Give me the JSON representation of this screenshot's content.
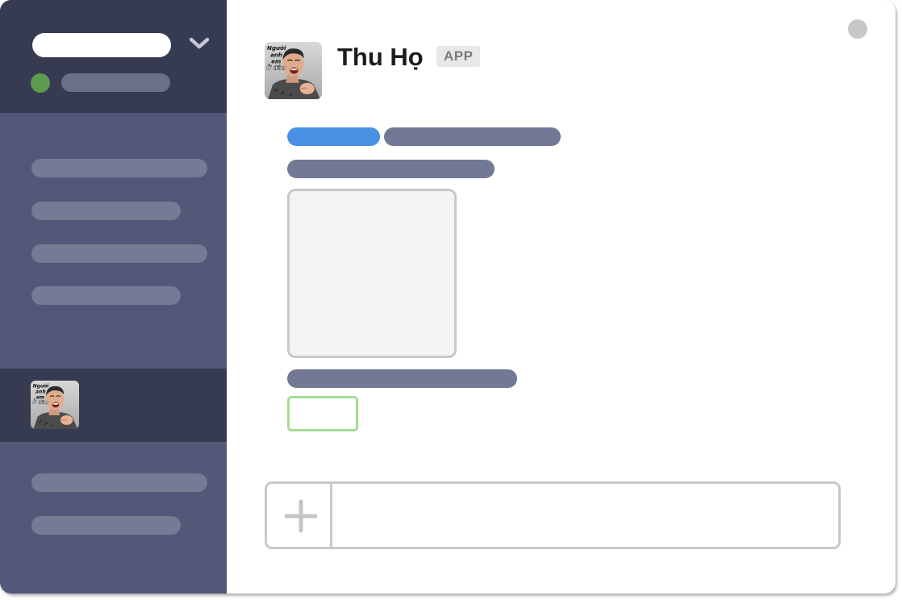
{
  "app": {
    "bot_name": "Thu Họ",
    "badge": "APP"
  },
  "avatar": {
    "caption_lines": [
      "Người",
      "anh",
      "em",
      "Ở đâu"
    ]
  },
  "composer": {
    "value": "",
    "placeholder": ""
  },
  "icons": {
    "workspace_menu": "chevron-down-icon",
    "composer_add": "plus-icon",
    "status": "status-dot-icon"
  },
  "colors": {
    "sidebar": "#525878",
    "sidebar_header": "#373b51",
    "accent_blue": "#4a90e2",
    "status_green": "#5c9a4f",
    "button_border_green": "#a5dc94"
  }
}
